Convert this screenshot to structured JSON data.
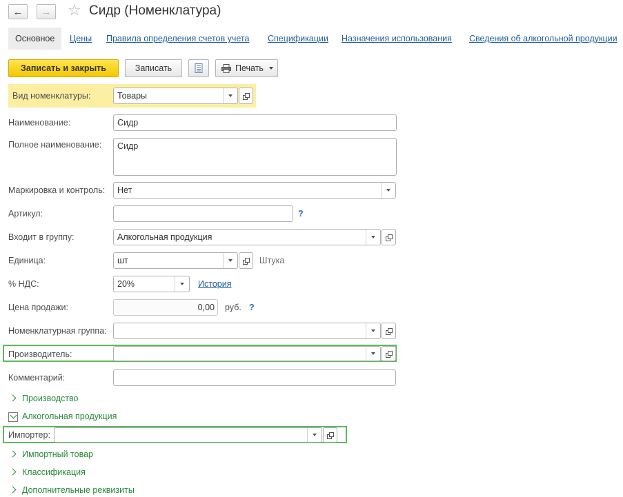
{
  "window": {
    "title": "Сидр (Номенклатура)"
  },
  "tabs": [
    {
      "label": "Основное",
      "active": true
    },
    {
      "label": "Цены"
    },
    {
      "label": "Правила определения счетов учета"
    },
    {
      "label": "Спецификации"
    },
    {
      "label": "Назначения использования"
    },
    {
      "label": "Сведения об алкогольной продукции"
    }
  ],
  "toolbar": {
    "save_close": "Записать и закрыть",
    "save": "Записать",
    "print": "Печать"
  },
  "form": {
    "kind_label": "Вид номенклатуры:",
    "kind_value": "Товары",
    "name_label": "Наименование:",
    "name_value": "Сидр",
    "fullname_label": "Полное наименование:",
    "fullname_value": "Сидр",
    "marking_label": "Маркировка и контроль:",
    "marking_value": "Нет",
    "article_label": "Артикул:",
    "article_value": "",
    "group_label": "Входит в группу:",
    "group_value": "Алкогольная продукция",
    "unit_label": "Единица:",
    "unit_value": "шт",
    "unit_hint": "Штука",
    "vat_label": "% НДС:",
    "vat_value": "20%",
    "vat_history": "История",
    "price_label": "Цена продажи:",
    "price_value": "0,00",
    "price_currency": "руб.",
    "help_mark": "?",
    "nomgroup_label": "Номенклатурная группа:",
    "nomgroup_value": "",
    "producer_label": "Производитель:",
    "producer_value": "",
    "comment_label": "Комментарий:",
    "comment_value": "",
    "importer_label": "Импортер:",
    "importer_value": ""
  },
  "groups": {
    "production": "Производство",
    "alcohol": "Алкогольная продукция",
    "imported": "Импортный товар",
    "classification": "Классификация",
    "additional": "Дополнительные реквизиты"
  },
  "colors": {
    "highlight_border": "#5cb85c",
    "kind_row_bg": "#fcefa1",
    "primary_button": "#f5c900",
    "link": "#1d5c9b",
    "group_text": "#2a8a3a"
  }
}
